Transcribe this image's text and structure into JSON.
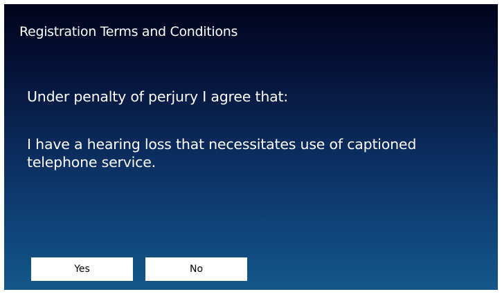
{
  "dialog": {
    "title": "Registration Terms and Conditions",
    "intro": "Under penalty of perjury I agree that:",
    "statement_line1": "I have a hearing loss that necessitates use of captioned",
    "statement_line2": "telephone service."
  },
  "buttons": {
    "yes_label": "Yes",
    "no_label": "No"
  },
  "colors": {
    "background_top": "#02031c",
    "background_bottom": "#14578a",
    "text": "#ffffff",
    "button_background": "#ffffff",
    "button_text": "#000000"
  }
}
